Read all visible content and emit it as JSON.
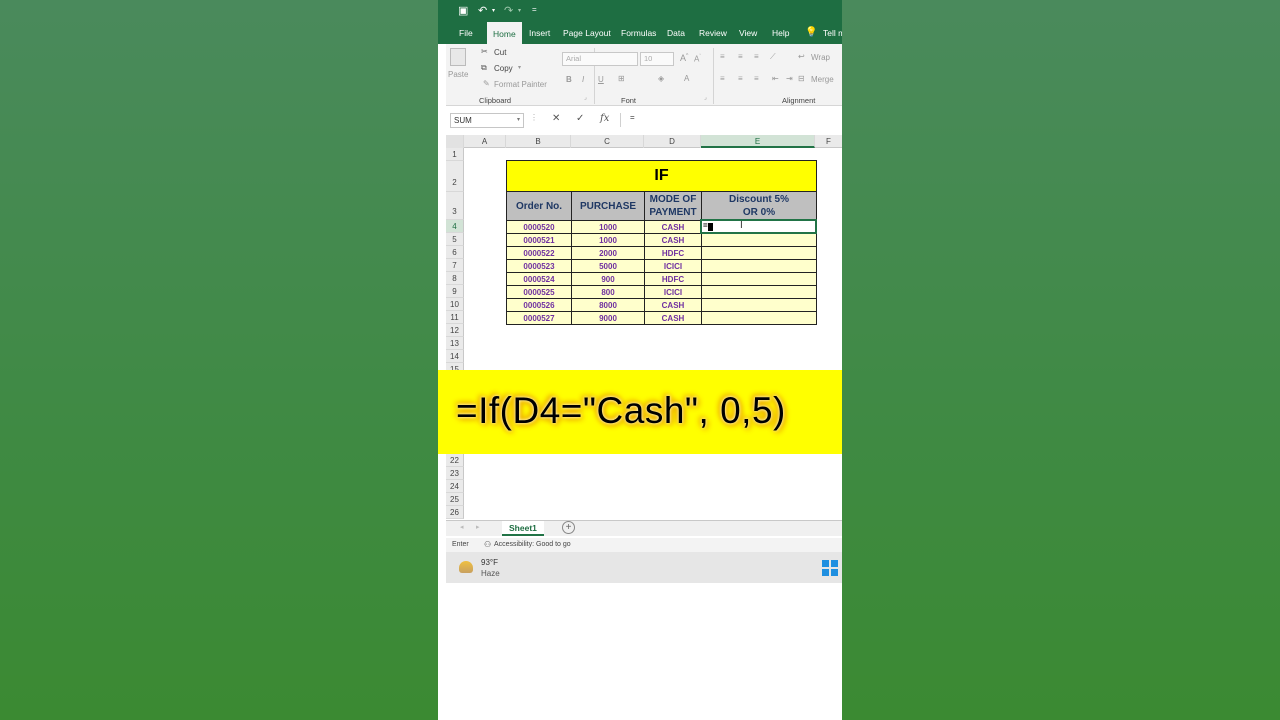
{
  "quick_access": {
    "save_icon": "save-icon",
    "undo_icon": "undo-icon",
    "redo_icon": "redo-icon",
    "more": "="
  },
  "tabs": [
    "File",
    "Home",
    "Insert",
    "Page Layout",
    "Formulas",
    "Data",
    "Review",
    "View",
    "Help",
    "Tell m"
  ],
  "ribbon": {
    "paste": "Paste",
    "cut": "Cut",
    "copy": "Copy",
    "format_painter": "Format Painter",
    "clipboard": "Clipboard",
    "font_name": "Arial",
    "font_size": "10",
    "bold": "B",
    "italic": "I",
    "underline": "U",
    "font_group": "Font",
    "wrap": "Wrap",
    "merge": "Merge",
    "alignment_group": "Alignment"
  },
  "formula_bar": {
    "name_box": "SUM",
    "cancel": "✕",
    "enter": "✓",
    "fx": "fx",
    "value": "="
  },
  "columns": [
    "A",
    "B",
    "C",
    "D",
    "E",
    "F"
  ],
  "rows_top": [
    "1",
    "2",
    "3",
    "4",
    "5",
    "6",
    "7",
    "8",
    "9",
    "10",
    "11",
    "12",
    "13",
    "14",
    "15"
  ],
  "rows_bottom": [
    "22",
    "23",
    "24",
    "25",
    "26"
  ],
  "table": {
    "title": "IF",
    "headers": [
      "Order No.",
      "PURCHASE",
      "MODE OF PAYMENT",
      "Discount 5% OR 0%"
    ],
    "rows": [
      [
        "0000520",
        "1000",
        "CASH"
      ],
      [
        "0000521",
        "1000",
        "CASH"
      ],
      [
        "0000522",
        "2000",
        "HDFC"
      ],
      [
        "0000523",
        "5000",
        "ICICI"
      ],
      [
        "0000524",
        "900",
        "HDFC"
      ],
      [
        "0000525",
        "800",
        "ICICI"
      ],
      [
        "0000526",
        "8000",
        "CASH"
      ],
      [
        "0000527",
        "9000",
        "CASH"
      ]
    ],
    "active_cell_value": "="
  },
  "banner": {
    "formula": "=If(D4=\"Cash\", 0,5)"
  },
  "sheet": {
    "name": "Sheet1",
    "add": "+"
  },
  "status": {
    "mode": "Enter",
    "accessibility": "Accessibility: Good to go"
  },
  "taskbar": {
    "temp": "93°F",
    "condition": "Haze"
  }
}
